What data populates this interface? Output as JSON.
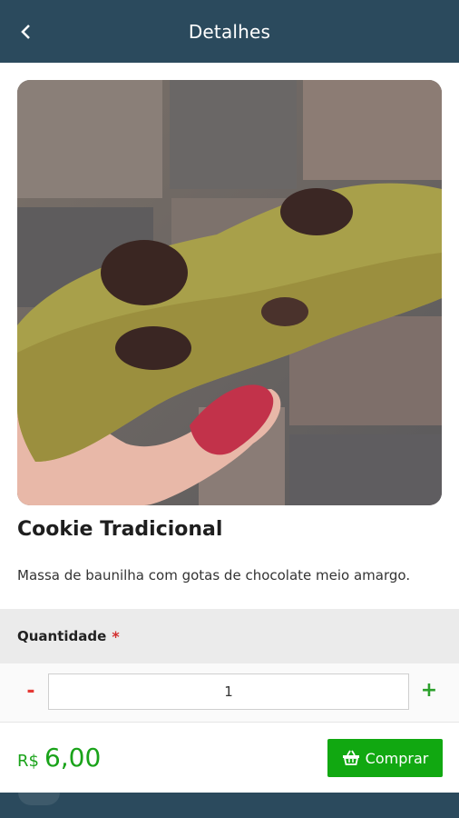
{
  "header": {
    "title": "Detalhes",
    "back_icon": "chevron-left-icon"
  },
  "product": {
    "image_alt": "cookie",
    "name": "Cookie Tradicional",
    "description": "Massa de baunilha com gotas de chocolate meio amargo."
  },
  "quantity": {
    "label": "Quantidade",
    "required_mark": "*",
    "minus_label": "-",
    "value": "1",
    "plus_label": "+"
  },
  "footer": {
    "currency": "R$",
    "price": "6,00",
    "buy_label": "Comprar",
    "buy_icon": "basket-icon"
  },
  "colors": {
    "header_bg": "#2b4a5d",
    "price_green": "#1aa31a",
    "buy_green": "#11a811",
    "minus_red": "#e53935",
    "plus_green": "#2ca02c"
  }
}
